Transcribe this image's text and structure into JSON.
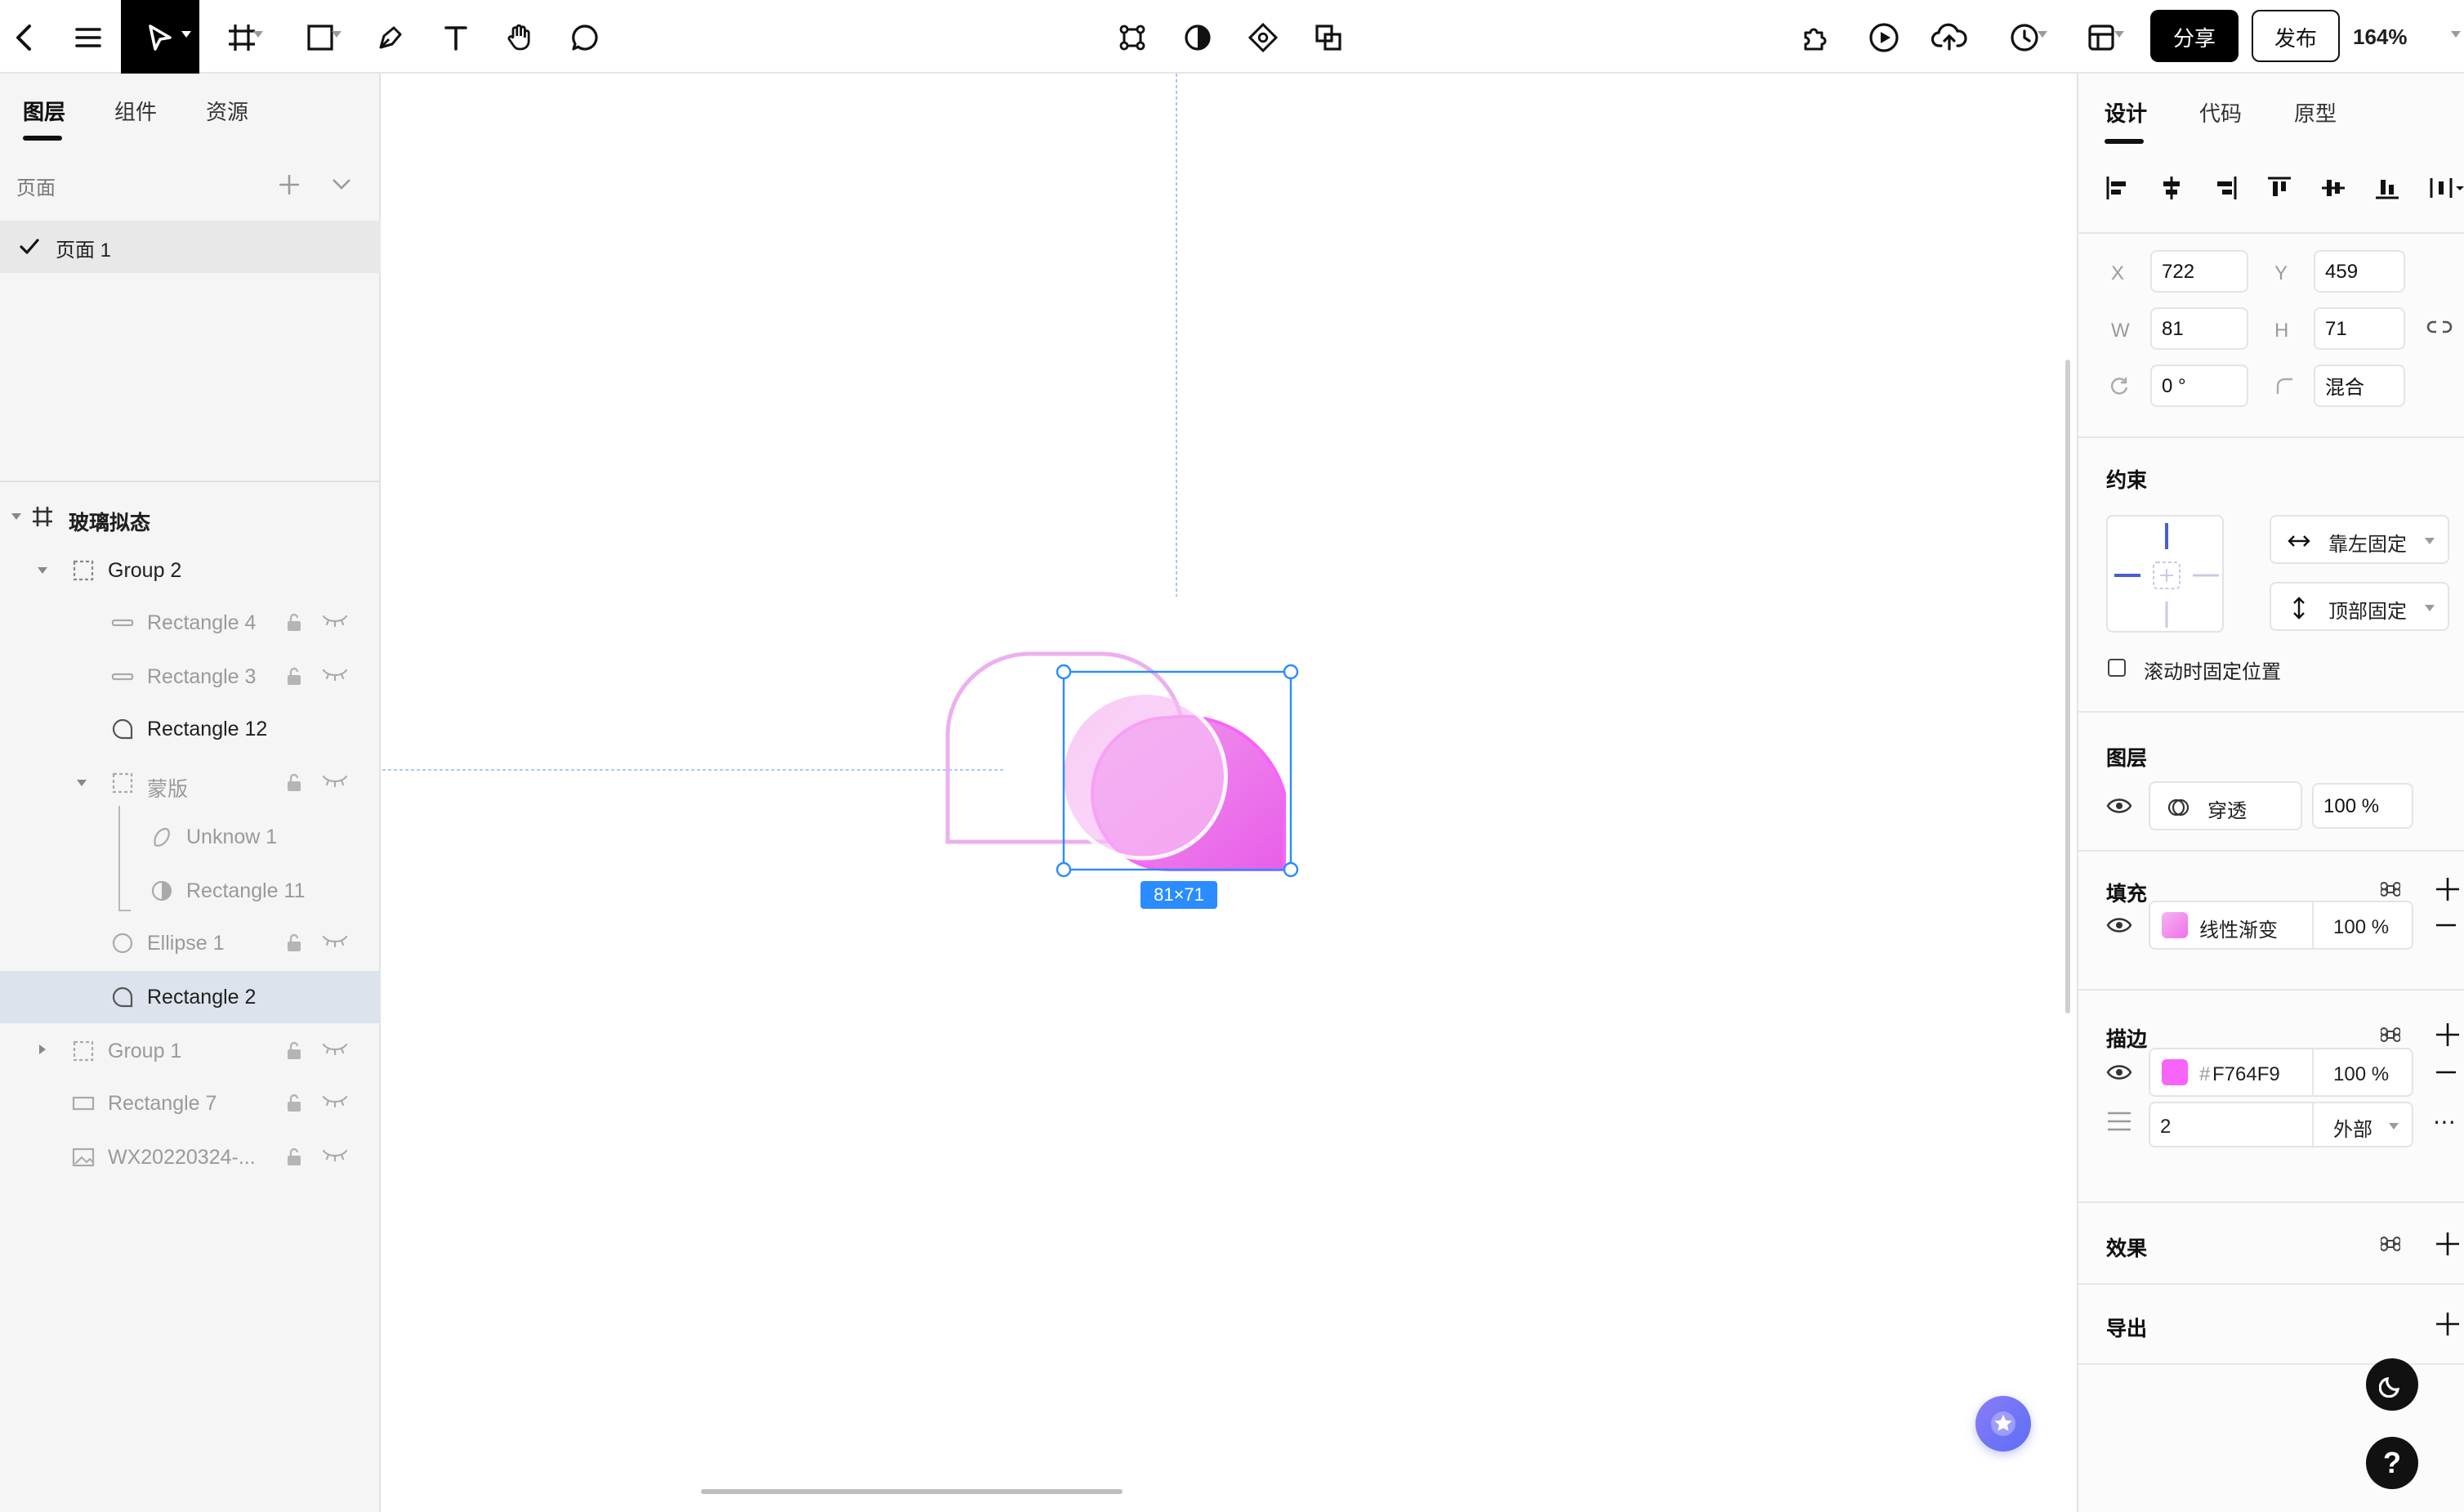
{
  "toolbar": {
    "share_label": "分享",
    "publish_label": "发布",
    "zoom": "164%"
  },
  "left_panel": {
    "tabs": [
      "图层",
      "组件",
      "资源"
    ],
    "pages_title": "页面",
    "current_page": "页面 1",
    "frame_name": "玻璃拟态",
    "layers": [
      {
        "name": "Group 2"
      },
      {
        "name": "Rectangle 4"
      },
      {
        "name": "Rectangle 3"
      },
      {
        "name": "Rectangle 12"
      },
      {
        "name": "蒙版"
      },
      {
        "name": "Unknow 1"
      },
      {
        "name": "Rectangle 11"
      },
      {
        "name": "Ellipse 1"
      },
      {
        "name": "Rectangle 2"
      },
      {
        "name": "Group 1"
      },
      {
        "name": "Rectangle 7"
      },
      {
        "name": "WX20220324-..."
      }
    ]
  },
  "canvas": {
    "size_badge": "81×71"
  },
  "right_panel": {
    "tabs": [
      "设计",
      "代码",
      "原型"
    ],
    "x_label": "X",
    "x_value": "722",
    "y_label": "Y",
    "y_value": "459",
    "w_label": "W",
    "w_value": "81",
    "h_label": "H",
    "h_value": "71",
    "rotation": "0 °",
    "radius": "混合",
    "constraints_title": "约束",
    "constraint_h": "靠左固定",
    "constraint_v": "顶部固定",
    "fixed_scroll_label": "滚动时固定位置",
    "layer_title": "图层",
    "blend_mode": "穿透",
    "layer_opacity": "100 %",
    "fill_title": "填充",
    "fill_type": "线性渐变",
    "fill_opacity": "100 %",
    "stroke_title": "描边",
    "stroke_hash": "#",
    "stroke_color": "F764F9",
    "stroke_opacity": "100 %",
    "stroke_width": "2",
    "stroke_position": "外部",
    "effects_title": "效果",
    "export_title": "导出"
  },
  "colors": {
    "accent": "#2a8cff",
    "stroke": "#F764F9",
    "gradient_start": "#f29af0",
    "gradient_end": "#e85ee8"
  }
}
